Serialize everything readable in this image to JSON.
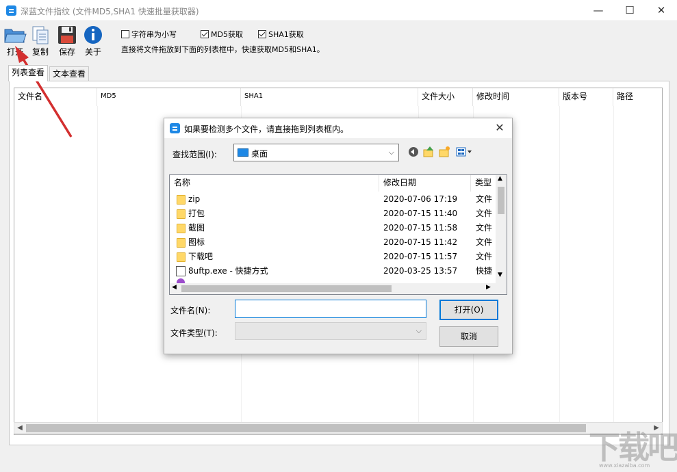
{
  "window": {
    "title": "深蓝文件指纹 (文件MD5,SHA1 快速批量获取器)",
    "minimize": "—",
    "maximize": "☐",
    "close": "✕"
  },
  "toolbar": {
    "open_label": "打开",
    "copy_label": "复制",
    "save_label": "保存",
    "about_label": "关于"
  },
  "options": {
    "lowercase_label": "字符串为小写",
    "lowercase_checked": false,
    "md5_label": "MD5获取",
    "md5_checked": true,
    "sha1_label": "SHA1获取",
    "sha1_checked": true,
    "hint": "直接将文件拖放到下面的列表框中，快速获取MD5和SHA1。"
  },
  "tabs": [
    "列表查看",
    "文本查看"
  ],
  "list": {
    "columns": [
      "文件名",
      "MD5",
      "SHA1",
      "文件大小",
      "修改时间",
      "版本号",
      "路径"
    ]
  },
  "dialog": {
    "title": "如果要检测多个文件，请直接拖到列表框内。",
    "look_in_label": "查找范围(I):",
    "look_in_value": "桌面",
    "columns": [
      "名称",
      "修改日期",
      "类型"
    ],
    "files": [
      {
        "name": "zip",
        "date": "2020-07-06 17:19",
        "type": "文件",
        "kind": "folder"
      },
      {
        "name": "打包",
        "date": "2020-07-15 11:40",
        "type": "文件",
        "kind": "folder"
      },
      {
        "name": "截图",
        "date": "2020-07-15 11:58",
        "type": "文件",
        "kind": "folder"
      },
      {
        "name": "图标",
        "date": "2020-07-15 11:42",
        "type": "文件",
        "kind": "folder"
      },
      {
        "name": "下载吧",
        "date": "2020-07-15 11:57",
        "type": "文件",
        "kind": "folder"
      },
      {
        "name": "8uftp.exe - 快捷方式",
        "date": "2020-03-25 13:57",
        "type": "快捷",
        "kind": "shortcut"
      }
    ],
    "filename_label": "文件名(N):",
    "filename_value": "",
    "filetype_label": "文件类型(T):",
    "filetype_value": "",
    "open_button": "打开(O)",
    "cancel_button": "取消"
  },
  "watermark": {
    "logo_text": "下载吧",
    "url_text": "www.xiazaiba.com"
  },
  "colors": {
    "accent": "#0078d7",
    "arrow": "#d32f2f",
    "folder": "#ffd868"
  }
}
